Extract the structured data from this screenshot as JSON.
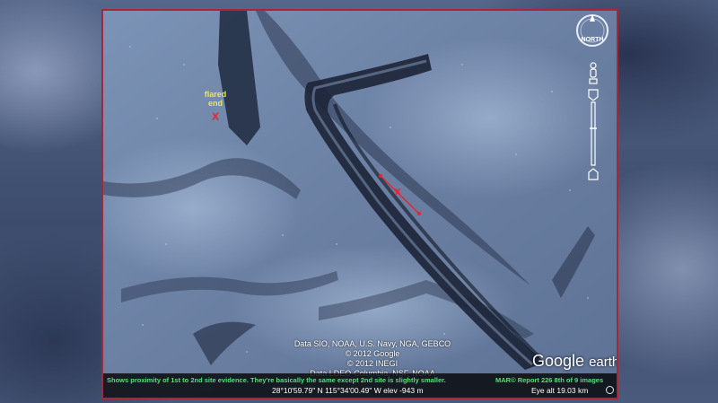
{
  "annotations": {
    "flared_label": "flared\nend",
    "flared_label_line1": "flared",
    "flared_label_line2": "end",
    "marker_symbol": "X"
  },
  "attribution": {
    "line1": "Data SIO, NOAA, U.S. Navy, NGA, GEBCO",
    "line2": "© 2012 Google",
    "line3": "© 2012 INEGI",
    "line4": "Data LDEO-Columbia, NSF, NOAA"
  },
  "logo": {
    "google": "Google",
    "earth": "earth"
  },
  "status_bar": {
    "caption": "Shows proximity of 1st to 2nd site evidence.  They're basically the same except 2nd site is slightly smaller.",
    "report": "MAR© Report 226   8th of 9 images",
    "coordinates": "28°10'59.79\" N 115°34'00.49\" W elev  -943 m",
    "eye_alt": "Eye alt    19.03 km"
  },
  "compass": {
    "label": "NORTH"
  },
  "icons": {
    "compass": "compass-ring-icon",
    "look": "look-joystick-icon",
    "pan": "pan-person-icon",
    "zoom": "zoom-slider-icon"
  },
  "colors": {
    "frame": "#a8263a",
    "status_text": "#4fe07a",
    "marker": "#e8242c",
    "label": "#f2e64a"
  }
}
